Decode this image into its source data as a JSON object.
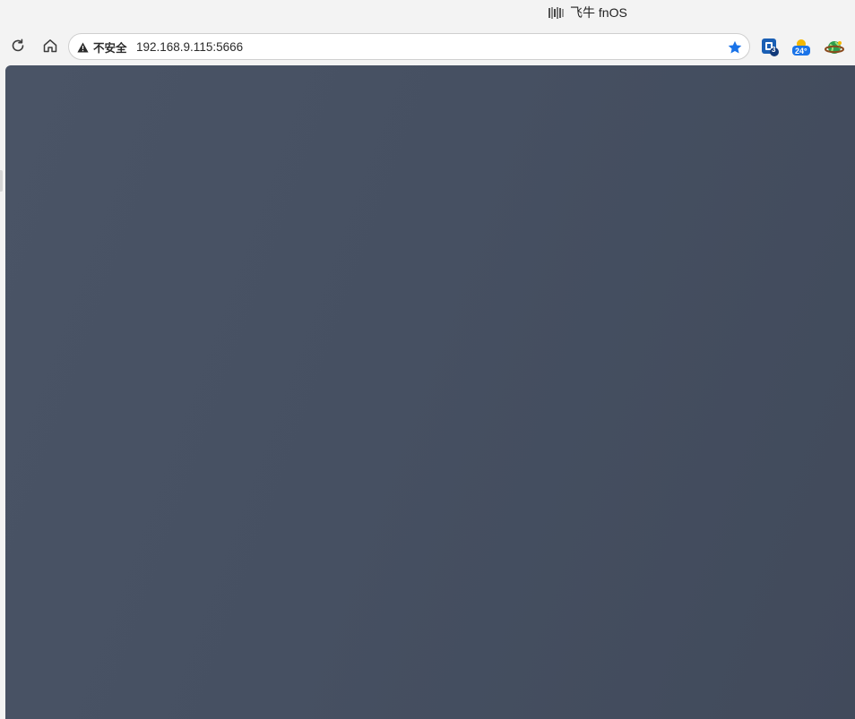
{
  "window": {
    "tab_title": "飞牛 fnOS"
  },
  "toolbar": {
    "security_label": "不安全",
    "url": "192.168.9.115:5666",
    "icons": [
      "reload-icon",
      "home-icon",
      "warning-icon",
      "bookmark-star-icon"
    ]
  },
  "extensions": [
    {
      "name": "ext-b-icon",
      "badge": "3"
    },
    {
      "name": "weather-icon",
      "badge": "24°"
    },
    {
      "name": "globe-ext-icon",
      "badge": ""
    }
  ],
  "colors": {
    "accent": "#1a73e8",
    "content_bg": "#465062"
  }
}
